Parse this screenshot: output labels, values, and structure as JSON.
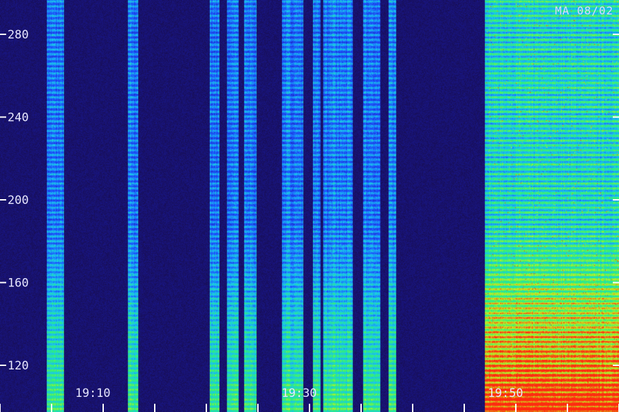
{
  "chart_data": {
    "type": "heatmap",
    "title": "",
    "xlabel": "",
    "ylabel": "",
    "corner_label": "MA 08/02",
    "y_ticks": [
      280,
      240,
      200,
      160,
      120
    ],
    "ylim": [
      110,
      290
    ],
    "x_tick_labels": [
      "19:10",
      "19:30",
      "19:50"
    ],
    "x_tick_values": [
      "19:10",
      "19:30",
      "19:50"
    ],
    "xlim": [
      "19:01",
      "20:01"
    ],
    "colormap": [
      "#16093a",
      "#1a1a9a",
      "#1d4dff",
      "#19c6f0",
      "#2ef07a",
      "#c8f020",
      "#ff2a10"
    ],
    "activity_onset": "19:48",
    "intensity_profile": {
      "description_free": true,
      "quiet_level": 0.05,
      "active_level_low_freq": 0.75,
      "active_level_high_freq": 0.45
    }
  }
}
